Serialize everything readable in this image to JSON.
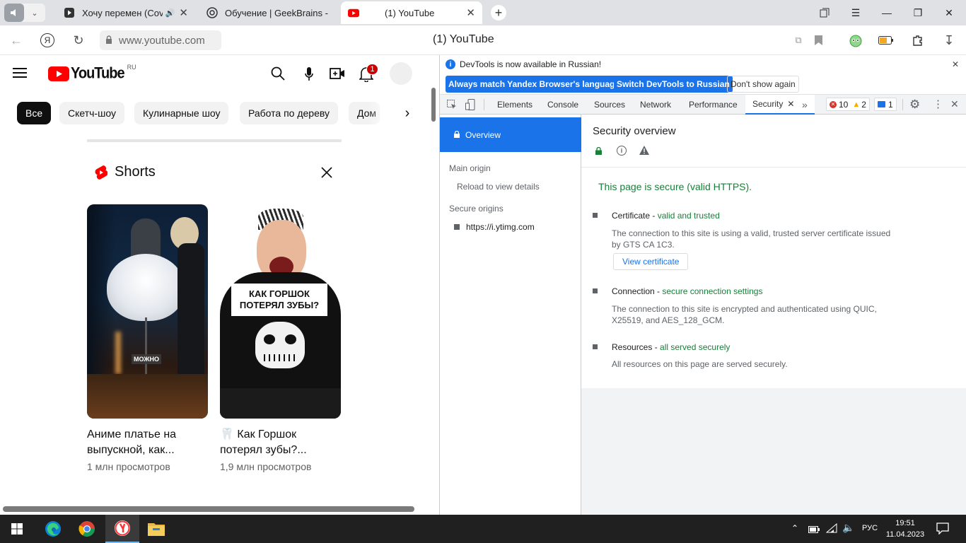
{
  "tabs": [
    {
      "title": "Хочу перемен (Cove",
      "icon": "play-icon",
      "audio": true
    },
    {
      "title": "Обучение | GeekBrains - о",
      "icon": "geekbrains-icon"
    },
    {
      "title": "(1) YouTube",
      "icon": "youtube-icon",
      "active": true
    }
  ],
  "address": {
    "url": "www.youtube.com",
    "page_title": "(1) YouTube"
  },
  "youtube": {
    "logo_text": "YouTube",
    "region": "RU",
    "notification_count": "1",
    "chips": [
      "Все",
      "Скетч-шоу",
      "Кулинарные шоу",
      "Работа по дереву",
      "Дом"
    ],
    "shorts_title": "Shorts",
    "shorts": [
      {
        "title_line1": "Аниме платье на",
        "title_line2": "выпускной, как...",
        "views": "1 млн просмотров",
        "overlay": "МОЖНО"
      },
      {
        "title_line1": "🦷 Как Горшок",
        "title_line2": "потерял зубы?...",
        "views": "1,9 млн просмотров",
        "overlay_line1": "КАК ГОРШОК",
        "overlay_line2": "ПОТЕРЯЛ ЗУБЫ?"
      }
    ]
  },
  "devtools": {
    "notice": "DevTools is now available in Russian!",
    "btn_match": "Always match Yandex Browser's language",
    "btn_switch": "Switch DevTools to Russian",
    "btn_dont": "Don't show again",
    "panel_tabs": [
      "Elements",
      "Console",
      "Sources",
      "Network",
      "Performance",
      "Security"
    ],
    "active_tab": "Security",
    "errors": "10",
    "warnings": "2",
    "messages": "1",
    "sidebar": {
      "overview": "Overview",
      "main_origin": "Main origin",
      "reload": "Reload to view details",
      "secure_origins": "Secure origins",
      "origin": "https://i.ytimg.com"
    },
    "security": {
      "heading": "Security overview",
      "summary": "This page is secure (valid HTTPS).",
      "cert_label": "Certificate - ",
      "cert_status": "valid and trusted",
      "cert_desc1": "The connection to this site is using a valid, trusted server certificate issued",
      "cert_desc2": "by GTS CA 1C3.",
      "view_cert": "View certificate",
      "conn_label": "Connection - ",
      "conn_status": "secure connection settings",
      "conn_desc1": "The connection to this site is encrypted and authenticated using QUIC,",
      "conn_desc2": "X25519, and AES_128_GCM.",
      "res_label": "Resources - ",
      "res_status": "all served securely",
      "res_desc": "All resources on this page are served securely."
    }
  },
  "taskbar": {
    "lang": "РУС",
    "time": "19:51",
    "date": "11.04.2023"
  },
  "colors": {
    "yt_red": "#ff0000",
    "dt_blue": "#1a73e8",
    "secure_green": "#188038",
    "taskbar": "#202020"
  }
}
